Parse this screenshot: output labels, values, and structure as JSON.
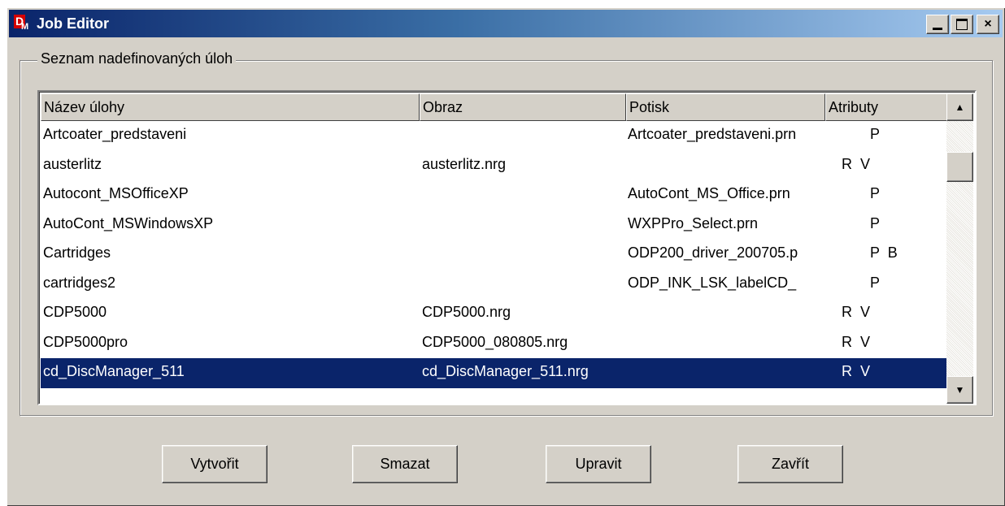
{
  "window": {
    "title": "Job Editor",
    "controls": {
      "minimize": "minimize",
      "maximize": "maximize",
      "close": "×"
    }
  },
  "group": {
    "label": "Seznam nadefinovaných úloh"
  },
  "list": {
    "columns": [
      "Název úlohy",
      "Obraz",
      "Potisk",
      "Atributy"
    ],
    "rows": [
      {
        "name": "Artcoater_predstaveni",
        "image": "",
        "print": "Artcoater_predstaveni.prn",
        "attrs": "       P"
      },
      {
        "name": "austerlitz",
        "image": "austerlitz.nrg",
        "print": "",
        "attrs": "R  V"
      },
      {
        "name": "Autocont_MSOfficeXP",
        "image": "",
        "print": "AutoCont_MS_Office.prn",
        "attrs": "       P"
      },
      {
        "name": "AutoCont_MSWindowsXP",
        "image": "",
        "print": "WXPPro_Select.prn",
        "attrs": "       P"
      },
      {
        "name": "Cartridges",
        "image": "",
        "print": "ODP200_driver_200705.p",
        "attrs": "       P  B"
      },
      {
        "name": "cartridges2",
        "image": "",
        "print": "ODP_INK_LSK_labelCD_",
        "attrs": "       P"
      },
      {
        "name": "CDP5000",
        "image": "CDP5000.nrg",
        "print": "",
        "attrs": "R  V"
      },
      {
        "name": "CDP5000pro",
        "image": "CDP5000_080805.nrg",
        "print": "",
        "attrs": "R  V"
      },
      {
        "name": "cd_DiscManager_511",
        "image": "cd_DiscManager_511.nrg",
        "print": "",
        "attrs": "R  V",
        "selected": true
      }
    ]
  },
  "buttons": {
    "create": "Vytvořit",
    "delete": "Smazat",
    "edit": "Upravit",
    "close": "Zavřít"
  }
}
